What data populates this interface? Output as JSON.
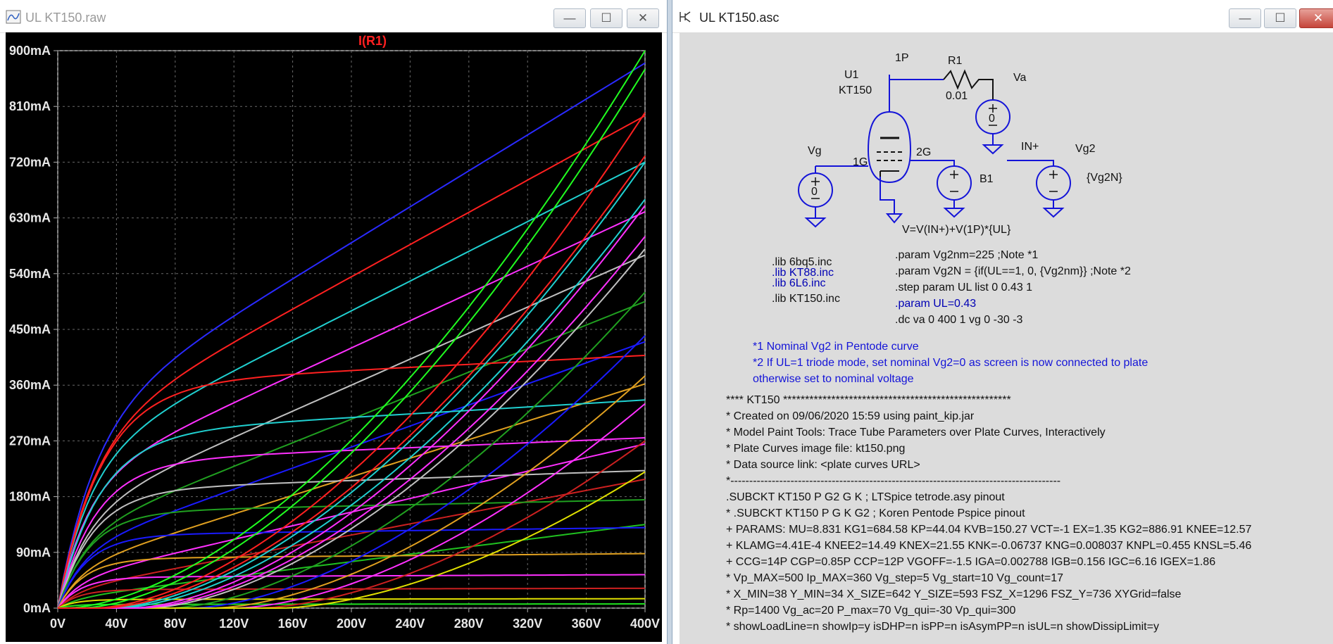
{
  "left_window": {
    "title": "UL KT150.raw",
    "buttons": {
      "minimize": "—",
      "maximize": "☐",
      "close": "✕"
    },
    "chart_data": {
      "type": "line",
      "title": "I(R1)",
      "title_color": "#ff2020",
      "xlabel": "",
      "ylabel": "",
      "xlim": [
        0,
        400
      ],
      "ylim": [
        0,
        900
      ],
      "x_ticks": [
        "0V",
        "40V",
        "80V",
        "120V",
        "160V",
        "200V",
        "240V",
        "280V",
        "320V",
        "360V",
        "400V"
      ],
      "y_ticks": [
        "0mA",
        "90mA",
        "180mA",
        "270mA",
        "360mA",
        "450mA",
        "540mA",
        "630mA",
        "720mA",
        "810mA",
        "900mA"
      ],
      "grid": true,
      "background": "#000000",
      "series": [
        {
          "color": "#2a2aff",
          "curve": "sat",
          "k": 25,
          "plateau": 300,
          "slope": 1.45
        },
        {
          "color": "#ff2020",
          "curve": "sat",
          "k": 24,
          "plateau": 275,
          "slope": 1.3
        },
        {
          "color": "#20d0d0",
          "curve": "sat",
          "k": 22,
          "plateau": 240,
          "slope": 1.2
        },
        {
          "color": "#ff30ff",
          "curve": "sat",
          "k": 20,
          "plateau": 200,
          "slope": 1.1
        },
        {
          "color": "#c0c0c0",
          "curve": "sat",
          "k": 20,
          "plateau": 150,
          "slope": 1.05
        },
        {
          "color": "#20a020",
          "curve": "sat",
          "k": 18,
          "plateau": 115,
          "slope": 0.95
        },
        {
          "color": "#1a1aff",
          "curve": "sat",
          "k": 17,
          "plateau": 90,
          "slope": 0.85
        },
        {
          "color": "#e0a020",
          "curve": "sat",
          "k": 16,
          "plateau": 62,
          "slope": 0.75
        },
        {
          "color": "#ff30ff",
          "curve": "sat",
          "k": 16,
          "plateau": 45,
          "slope": 0.55
        },
        {
          "color": "#cc2020",
          "curve": "sat",
          "k": 15,
          "plateau": 28,
          "slope": 0.45
        },
        {
          "color": "#20c020",
          "curve": "sat",
          "k": 15,
          "plateau": 15,
          "slope": 0.3
        },
        {
          "color": "#ff2020",
          "curve": "flat",
          "k": 30,
          "plateau": 360,
          "slope": 0.12
        },
        {
          "color": "#20d0d0",
          "curve": "flat",
          "k": 28,
          "plateau": 280,
          "slope": 0.14
        },
        {
          "color": "#ff30ff",
          "curve": "flat",
          "k": 26,
          "plateau": 235,
          "slope": 0.1
        },
        {
          "color": "#c0c0c0",
          "curve": "flat",
          "k": 24,
          "plateau": 190,
          "slope": 0.08
        },
        {
          "color": "#20a020",
          "curve": "flat",
          "k": 22,
          "plateau": 155,
          "slope": 0.05
        },
        {
          "color": "#1a1aff",
          "curve": "flat",
          "k": 20,
          "plateau": 118,
          "slope": 0.03
        },
        {
          "color": "#e0a020",
          "curve": "flat",
          "k": 18,
          "plateau": 80,
          "slope": 0.02
        },
        {
          "color": "#ff30ff",
          "curve": "flat",
          "k": 16,
          "plateau": 50,
          "slope": 0.01
        },
        {
          "color": "#cc2020",
          "curve": "flat",
          "k": 14,
          "plateau": 30,
          "slope": 0.005
        },
        {
          "color": "#e0e000",
          "curve": "flat",
          "k": 12,
          "plateau": 14,
          "slope": 0.003
        },
        {
          "color": "#20e020",
          "curve": "flat",
          "k": 10,
          "plateau": 6,
          "slope": 0.002
        },
        {
          "color": "#20ff20",
          "curve": "pow",
          "x0": 15,
          "end": 870
        },
        {
          "color": "#ff2020",
          "curve": "pow",
          "x0": 25,
          "end": 800
        },
        {
          "color": "#20d0d0",
          "curve": "pow",
          "x0": 35,
          "end": 720
        },
        {
          "color": "#ff30ff",
          "curve": "pow",
          "x0": 50,
          "end": 650
        },
        {
          "color": "#c0c0c0",
          "curve": "pow",
          "x0": 60,
          "end": 580
        },
        {
          "color": "#20a020",
          "curve": "pow",
          "x0": 75,
          "end": 510
        },
        {
          "color": "#1a1aff",
          "curve": "pow",
          "x0": 90,
          "end": 440
        },
        {
          "color": "#e0a020",
          "curve": "pow",
          "x0": 105,
          "end": 375
        },
        {
          "color": "#ff30ff",
          "curve": "pow",
          "x0": 120,
          "end": 330
        },
        {
          "color": "#cc2020",
          "curve": "pow",
          "x0": 135,
          "end": 270
        },
        {
          "color": "#e0e000",
          "curve": "pow",
          "x0": 150,
          "end": 220
        },
        {
          "color": "#20ff20",
          "curve": "pow",
          "x0": 5,
          "end": 900
        },
        {
          "color": "#20d0d0",
          "curve": "pow",
          "x0": 40,
          "end": 660
        },
        {
          "color": "#ff30ff",
          "curve": "pow",
          "x0": 55,
          "end": 600
        },
        {
          "color": "#ff2020",
          "curve": "pow",
          "x0": 30,
          "end": 730
        }
      ]
    }
  },
  "right_window": {
    "title": "UL KT150.asc",
    "buttons": {
      "minimize": "—",
      "maximize": "☐",
      "close": "✕"
    },
    "schematic": {
      "u1": "U1",
      "u1_model": "KT150",
      "pin_1p": "1P",
      "pin_1g": "1G",
      "pin_2g": "2G",
      "r1": "R1",
      "r1_value": "0.01",
      "va": "Va",
      "va_value": "0",
      "vg": "Vg",
      "vg_value": "0",
      "b1": "B1",
      "b1_expr": "V=V(IN+)+V(1P)*{UL}",
      "in_plus": "IN+",
      "vg2": "Vg2",
      "vg2_value": "{Vg2N}"
    },
    "directives": {
      "lib1": ".lib 6bq5.inc",
      "lib2": ".lib KT88.inc",
      "lib3": ".lib 6L6.inc",
      "lib4": ".lib KT150.inc",
      "param1": ".param Vg2nm=225  ;Note *1",
      "param2": ".param Vg2N = {if(UL==1, 0, {Vg2nm}}   ;Note *2",
      "step": ".step param UL list 0 0.43 1",
      "param3": ".param UL=0.43",
      "dc": ".dc va 0 400 1 vg 0 -30 -3"
    },
    "notes": {
      "n1": "*1 Nominal Vg2  in Pentode curve",
      "n2": "*2 If UL=1 triode mode, set nominal Vg2=0 as screen is now connected to plate",
      "n3": "otherwise set to nominal voltage"
    },
    "model_text": [
      "**** KT150 ****************************************************",
      "* Created on 09/06/2020 15:59 using paint_kip.jar",
      "* Model Paint Tools: Trace Tube Parameters over Plate Curves, Interactively",
      "* Plate Curves image file: kt150.png",
      "* Data source link: <plate curves URL>",
      "*----------------------------------------------------------------------------------------",
      ".SUBCKT KT150 P G2 G K ; LTSpice tetrode.asy pinout",
      "* .SUBCKT KT150 P G K G2 ; Koren Pentode Pspice pinout",
      "+ PARAMS: MU=8.831 KG1=684.58 KP=44.04 KVB=150.27 VCT=-1 EX=1.35 KG2=886.91 KNEE=12.57",
      "+ KLAMG=4.41E-4 KNEE2=14.49 KNEX=21.55  KNK=-0.06737 KNG=0.008037 KNPL=0.455 KNSL=5.46",
      "+ CCG=14P CGP=0.85P CCP=12P VGOFF=-1.5 IGA=0.002788 IGB=0.156 IGC=6.16 IGEX=1.86",
      "* Vp_MAX=500 Ip_MAX=360 Vg_step=5 Vg_start=10 Vg_count=17",
      "* X_MIN=38 Y_MIN=34 X_SIZE=642 Y_SIZE=593 FSZ_X=1296 FSZ_Y=736 XYGrid=false",
      "* Rp=1400 Vg_ac=20 P_max=70 Vg_qui=-30 Vp_qui=300",
      "* showLoadLine=n showIp=y isDHP=n isPP=n isAsymPP=n isUL=n showDissipLimit=y"
    ]
  }
}
